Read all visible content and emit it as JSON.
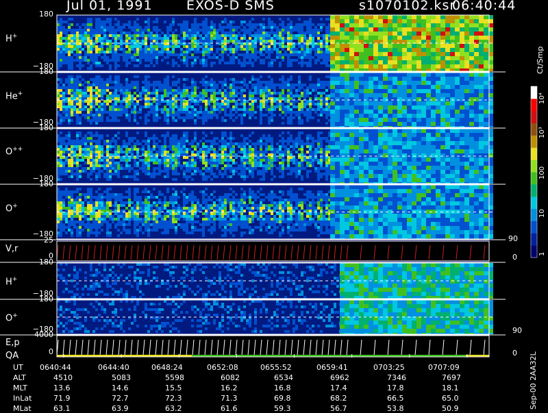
{
  "header": {
    "date": "Jul 01, 1991",
    "mission": "EXOS-D SMS",
    "file": "s1070102.ksr",
    "time": "06:40:44"
  },
  "panels": [
    {
      "id": "h-plus",
      "label": "H",
      "sup": "+",
      "y_top": "180",
      "y_bottom": "−180"
    },
    {
      "id": "he-plus",
      "label": "He",
      "sup": "+",
      "y_top": "180",
      "y_bottom": "−180"
    },
    {
      "id": "o-plus-plus",
      "label": "O",
      "sup": "++",
      "y_top": "180",
      "y_bottom": "−180"
    },
    {
      "id": "o-plus",
      "label": "O",
      "sup": "+",
      "y_top": "180",
      "y_bottom": "−180"
    },
    {
      "id": "v-r",
      "label": "V,r",
      "sup": "",
      "y_top": "25",
      "y_bottom": "0",
      "right_top": "90",
      "right_bottom": "0"
    },
    {
      "id": "h-plus-2",
      "label": "H",
      "sup": "+",
      "y_top": "180",
      "y_bottom": "−180"
    },
    {
      "id": "o-plus-2",
      "label": "O",
      "sup": "+",
      "y_top": "180",
      "y_bottom": "−180",
      "right_bottom": "90"
    },
    {
      "id": "e-p",
      "label": "E,p",
      "label2": "QA",
      "sup": "",
      "y_top": "4000",
      "y_bottom": "0",
      "right_bottom": "0"
    }
  ],
  "colorbar": {
    "unit": "Ct/Smp",
    "ticks": [
      "1",
      "10",
      "100",
      "10³",
      "10⁴"
    ],
    "colors": [
      "#000070",
      "#0020a0",
      "#0050d0",
      "#0090e0",
      "#00c8e0",
      "#00b070",
      "#40c020",
      "#90e020",
      "#e8e020",
      "#c09000",
      "#905010",
      "#d01010",
      "#ff0000",
      "#ffffff"
    ]
  },
  "footer": {
    "rows": [
      {
        "label": "UT",
        "values": [
          "0640:44",
          "0644:40",
          "0648:24",
          "0652:08",
          "0655:52",
          "0659:41",
          "0703:25",
          "0707:09"
        ]
      },
      {
        "label": "ALT",
        "values": [
          "4510",
          "5083",
          "5598",
          "6082",
          "6534",
          "6962",
          "7346",
          "7697"
        ]
      },
      {
        "label": "MLT",
        "values": [
          "13.6",
          "14.6",
          "15.5",
          "16.2",
          "16.8",
          "17.4",
          "17.8",
          "18.1"
        ]
      },
      {
        "label": "InLat",
        "values": [
          "71.9",
          "72.7",
          "72.3",
          "71.3",
          "69.8",
          "68.2",
          "66.5",
          "65.0"
        ]
      },
      {
        "label": "MLat",
        "values": [
          "63.1",
          "63.9",
          "63.2",
          "61.6",
          "59.3",
          "56.7",
          "53.8",
          "50.9"
        ]
      }
    ],
    "side_stamp": "Sep-00 2AA32L"
  },
  "chart_data": {
    "type": "heatmap",
    "title": "Jul 01, 1991   EXOS-D SMS",
    "x_ticks": [
      "0640:44",
      "0644:40",
      "0648:24",
      "0652:08",
      "0655:52",
      "0659:41",
      "0703:25",
      "0707:09"
    ],
    "ylim": [
      -180,
      180
    ],
    "colorbar_label": "Ct/Smp",
    "colorbar_ticks": [
      "1",
      "10",
      "100",
      "10³",
      "10⁴"
    ],
    "series": [
      {
        "name": "H+"
      },
      {
        "name": "He+"
      },
      {
        "name": "O++"
      },
      {
        "name": "O+"
      },
      {
        "name": "V,r"
      },
      {
        "name": "H+"
      },
      {
        "name": "O+"
      },
      {
        "name": "E,p"
      }
    ]
  }
}
